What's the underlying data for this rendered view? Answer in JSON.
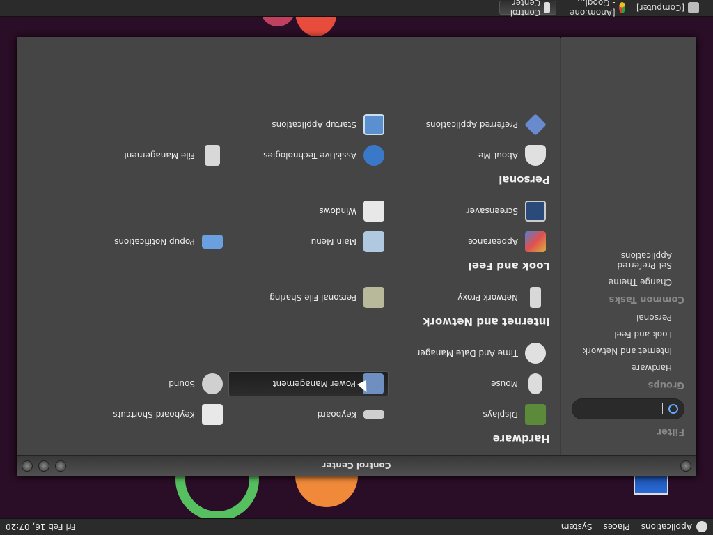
{
  "top_panel": {
    "menus": [
      "Applications",
      "Places",
      "System"
    ],
    "clock": "Fri Feb 16, 07:20"
  },
  "bottom_panel": {
    "tasks": [
      {
        "label": "[Computer]",
        "active": false
      },
      {
        "label": "[Anom.one - Googl...",
        "active": false
      },
      {
        "label": "Control Center",
        "active": true
      }
    ]
  },
  "window": {
    "title": "Control Center",
    "sidebar": {
      "filter_heading": "Filter",
      "groups_heading": "Groups",
      "groups": [
        "Hardware",
        "Internet and Network",
        "Look and Feel",
        "Personal"
      ],
      "common_heading": "Common Tasks",
      "tasks": [
        "Change Theme",
        "Set Preferred Applications"
      ]
    },
    "sections": [
      {
        "title": "Hardware",
        "items": [
          {
            "label": "Displays",
            "icon": "display-icon",
            "color": "#5a8a3a"
          },
          {
            "label": "Keyboard",
            "icon": "keyboard-icon",
            "color": "#cfcfcf"
          },
          {
            "label": "Keyboard Shortcuts",
            "icon": "keyboard-shortcuts-icon",
            "color": "#e8e8e8"
          },
          {
            "label": "Mouse",
            "icon": "mouse-icon",
            "color": "#dcdcdc"
          },
          {
            "label": "Power Management",
            "icon": "power-icon",
            "color": "#6f8fc0"
          },
          {
            "label": "Sound",
            "icon": "sound-icon",
            "color": "#d0d0d0"
          }
        ]
      },
      {
        "title": "",
        "items": [
          {
            "label": "Time And Date Manager",
            "icon": "clock-icon",
            "color": "#e0e0e0"
          }
        ]
      },
      {
        "title": "Internet and Network",
        "items": [
          {
            "label": "Network Proxy",
            "icon": "network-proxy-icon",
            "color": "#d8d8d8"
          },
          {
            "label": "Personal File Sharing",
            "icon": "file-sharing-icon",
            "color": "#b8b89a"
          }
        ]
      },
      {
        "title": "Look and Feel",
        "items": [
          {
            "label": "Appearance",
            "icon": "appearance-icon",
            "color": "#d8b040"
          },
          {
            "label": "Main Menu",
            "icon": "main-menu-icon",
            "color": "#b0c8e0"
          },
          {
            "label": "Popup Notifications",
            "icon": "popup-notifications-icon",
            "color": "#6aa0e0"
          },
          {
            "label": "Screensaver",
            "icon": "screensaver-icon",
            "color": "#2a4a7a"
          },
          {
            "label": "Windows",
            "icon": "windows-icon",
            "color": "#e8e8e8"
          }
        ]
      },
      {
        "title": "Personal",
        "items": [
          {
            "label": "About Me",
            "icon": "about-me-icon",
            "color": "#e0e0e0"
          },
          {
            "label": "Assistive Technologies",
            "icon": "assistive-icon",
            "color": "#3a78c8"
          },
          {
            "label": "File Management",
            "icon": "file-management-icon",
            "color": "#d8d8d8"
          },
          {
            "label": "Preferred Applications",
            "icon": "preferred-apps-icon",
            "color": "#6a8ad0"
          },
          {
            "label": "Startup Applications",
            "icon": "startup-apps-icon",
            "color": "#5a90d0"
          }
        ]
      }
    ],
    "selected_item": "Power Management"
  }
}
